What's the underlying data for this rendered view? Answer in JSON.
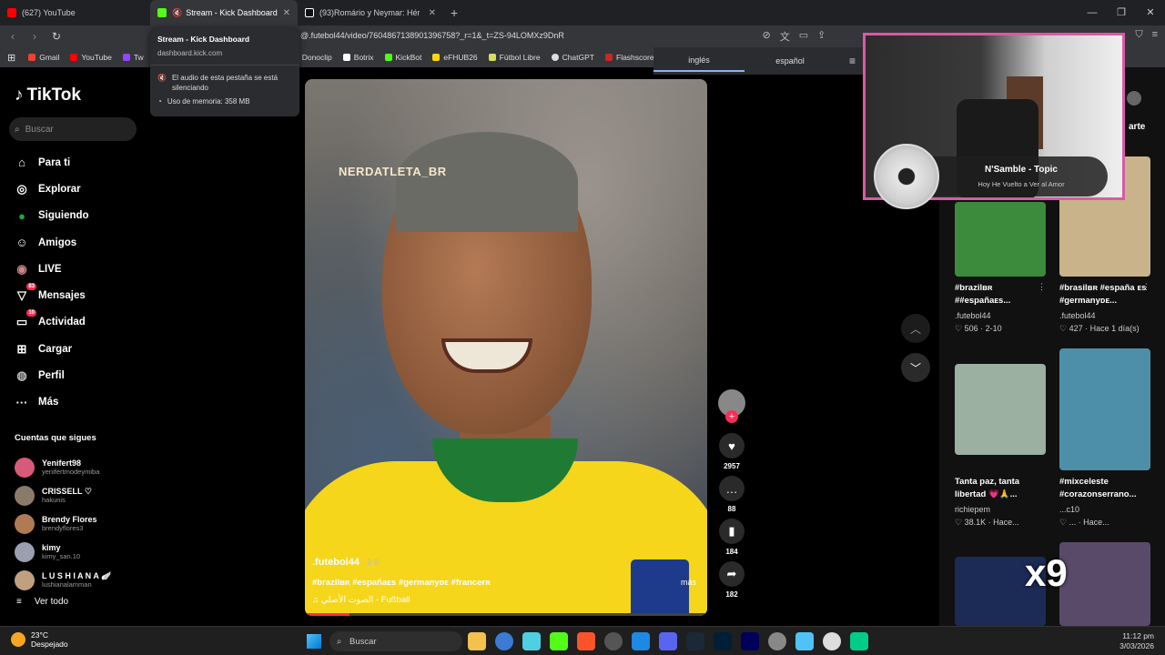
{
  "browser": {
    "tabs": [
      {
        "title": "(627) YouTube",
        "color": "#ff0000"
      },
      {
        "title": "Stream - Kick Dashboard",
        "color": "#53fc18",
        "muted": true
      },
      {
        "title": "(93)Romário y Neymar: Héroe",
        "color": "#ffffff"
      }
    ],
    "new_tab": "+",
    "url": "@.futebol44/video/7604867138901396758?_r=1&_t=ZS-94LOMXz9DnR",
    "bookmarks": [
      {
        "label": "Gmail",
        "color": "#ea4335"
      },
      {
        "label": "YouTube",
        "color": "#ff0000"
      },
      {
        "label": "Tw",
        "color": "#9146ff"
      },
      {
        "label": "Donoclip",
        "color": "#ffb300"
      },
      {
        "label": "Botrix",
        "color": "#ffffff"
      },
      {
        "label": "KickBot",
        "color": "#53fc18"
      },
      {
        "label": "eFHUB26",
        "color": "#ffd600"
      },
      {
        "label": "Fútbol Libre",
        "color": "#d4e157"
      },
      {
        "label": "ChatGPT",
        "color": "#dddddd"
      },
      {
        "label": "Flashscore",
        "color": "#c62828"
      }
    ]
  },
  "hover_card": {
    "title": "Stream - Kick Dashboard",
    "domain": "dashboard.kick.com",
    "muted_text": "El audio de esta pestaña se está silenciando",
    "memory_text": "Uso de memoria: 358 MB"
  },
  "translate": {
    "from": "inglés",
    "to": "español"
  },
  "tiktok": {
    "logo": "TikTok",
    "search_placeholder": "Buscar",
    "nav": [
      {
        "label": "Para ti",
        "icon": "home-icon",
        "glyph": "⌂"
      },
      {
        "label": "Explorar",
        "icon": "compass-icon",
        "glyph": "◎"
      },
      {
        "label": "Siguiendo",
        "icon": "following-icon",
        "glyph": "●"
      },
      {
        "label": "Amigos",
        "icon": "friends-icon",
        "glyph": "☺"
      },
      {
        "label": "LIVE",
        "icon": "live-icon",
        "glyph": "◉"
      },
      {
        "label": "Mensajes",
        "icon": "messages-icon",
        "glyph": "▽",
        "badge": "83"
      },
      {
        "label": "Actividad",
        "icon": "activity-icon",
        "glyph": "▭",
        "badge": "10"
      },
      {
        "label": "Cargar",
        "icon": "upload-icon",
        "glyph": "⊞"
      },
      {
        "label": "Perfil",
        "icon": "profile-icon",
        "glyph": "◍"
      },
      {
        "label": "Más",
        "icon": "more-icon",
        "glyph": "···"
      }
    ],
    "following_header": "Cuentas que sigues",
    "following": [
      {
        "name": "Yenifert98",
        "handle": "yenifertmodeymiba",
        "color": "#d85a7a"
      },
      {
        "name": "CRISSELL ♡",
        "handle": "hakunis",
        "color": "#8a7a6a"
      },
      {
        "name": "Brendy Flores",
        "handle": "brendyflores3",
        "color": "#b07a55"
      },
      {
        "name": "kimy",
        "handle": "kimy_san.10",
        "color": "#9aa0b0"
      },
      {
        "name": "L U S H I A N A 🪽",
        "handle": "lushianalamman",
        "color": "#c0a080"
      }
    ],
    "see_all": "Ver todo"
  },
  "video": {
    "watermark": "NERDATLETA_BR",
    "author": ".futebol44",
    "date": " · 2-9",
    "tags": "#brazilʙʀ #españaᴇs #germanyᴅᴇ #franceғʀ",
    "more": "más",
    "sound": "♫ الصوت الأصلي - Fußball",
    "progress": 0.11,
    "likes": "2957",
    "comments": "88",
    "saves": "184",
    "shares": "182"
  },
  "right_panel": {
    "header": "arte",
    "items": [
      {
        "title": "#brazilʙʀ ##españaᴇs...",
        "author": ".futebol44",
        "stats": "♡ 506 · 2-10",
        "color": "#3c8a3c"
      },
      {
        "title": "#brasilʙʀ #españa ᴇs #germanyᴅᴇ...",
        "author": ".futebol44",
        "stats": "♡ 427 · Hace 1 día(s)",
        "color": "#c9b38a"
      },
      {
        "title": "Tanta paz, tanta libertad 💗🙏...",
        "author": "richiepem",
        "stats": "♡ 38.1K · Hace...",
        "color": "#9bb0a0"
      },
      {
        "title": "#mixceleste #corazonserrano...",
        "author": "...c10",
        "stats": "♡ ... · Hace...",
        "color": "#4d8fa8"
      }
    ]
  },
  "now_playing": {
    "title": "N'Samble - Topic",
    "subtitle": "Hoy He Vuelto a Ver al Amor"
  },
  "overlay_multiplier": "x9",
  "taskbar": {
    "temp": "23°C",
    "weather": "Despejado",
    "search": "Buscar",
    "time": "11:12 pm",
    "date": "3/03/2026"
  }
}
